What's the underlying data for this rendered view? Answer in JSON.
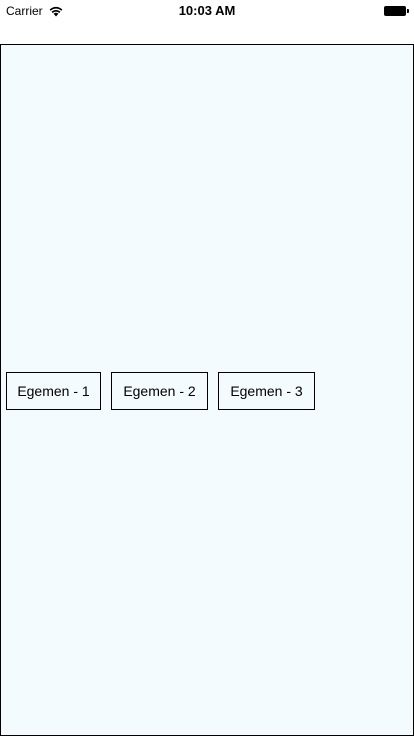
{
  "status_bar": {
    "carrier": "Carrier",
    "time": "10:03 AM",
    "icons": [
      "wifi-icon",
      "battery-icon"
    ]
  },
  "content": {
    "background_color": "#f4fbff",
    "buttons": [
      {
        "label": "Egemen - 1"
      },
      {
        "label": "Egemen - 2"
      },
      {
        "label": "Egemen - 3"
      }
    ]
  }
}
